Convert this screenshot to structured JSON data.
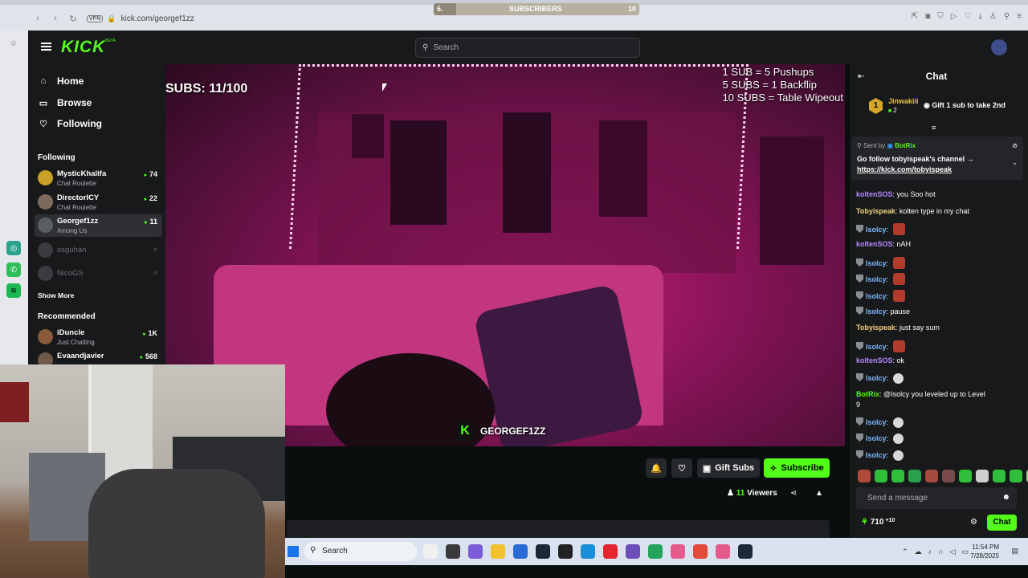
{
  "browser": {
    "url": "kick.com/georgef1zz",
    "vpn_label": "VPN",
    "sub_goal": {
      "left": "6.",
      "label": "SUBSCRIBERS",
      "right": "10",
      "progress": 0.11
    }
  },
  "header": {
    "logo": "KICK",
    "logo_badge": "BETA",
    "search_placeholder": "Search"
  },
  "sidebar": {
    "nav": [
      {
        "label": "Home",
        "icon": "home-icon"
      },
      {
        "label": "Browse",
        "icon": "browse-icon"
      },
      {
        "label": "Following",
        "icon": "heart-icon"
      }
    ],
    "following_title": "Following",
    "following": [
      {
        "name": "MysticKhalifa",
        "category": "Chat Roulette",
        "viewers": "74",
        "online": true,
        "avatar_color": "#c9a227"
      },
      {
        "name": "DirectorICY",
        "category": "Chat Roulette",
        "viewers": "22",
        "online": true,
        "avatar_color": "#7d6a5c"
      },
      {
        "name": "Georgef1zz",
        "category": "Among Us",
        "viewers": "11",
        "online": true,
        "avatar_color": "#5a5e62"
      },
      {
        "name": "osguhan",
        "category": "",
        "viewers": "",
        "online": false,
        "avatar_color": "#6c6f73"
      },
      {
        "name": "NicoGS",
        "category": "",
        "viewers": "",
        "online": false,
        "avatar_color": "#6c6f73"
      }
    ],
    "show_more": "Show More",
    "recommended_title": "Recommended",
    "recommended": [
      {
        "name": "iDuncle",
        "category": "Just Chatting",
        "viewers": "1K",
        "avatar_color": "#8a5a3a"
      },
      {
        "name": "Evaandjavier",
        "category": "",
        "viewers": "568",
        "avatar_color": "#6f5a4a"
      }
    ]
  },
  "stream": {
    "overlay_subs": "SUBS: 11/100",
    "goals": [
      "1 SUB   = 5 Pushups",
      "5 SUBS   = 1 Backflip",
      "10 SUBS = Table Wipeout"
    ],
    "watermark": "GEORGEF1ZZ",
    "gift_subs": "Gift Subs",
    "subscribe": "Subscribe",
    "viewers_count": "11",
    "viewers_label": "Viewers"
  },
  "chat": {
    "title": "Chat",
    "top_gifter": {
      "rank": "1",
      "user": "Jinwakiii",
      "count": "2",
      "cta": "Gift 1 sub to take 2nd"
    },
    "pinned": {
      "sent_by_prefix": "Sent by",
      "sender": "BotRix",
      "message": "Go follow tobyispeak's channel →",
      "link": "https://kick.com/tobyispeak"
    },
    "messages": [
      {
        "user": "koltenSOS",
        "text": "you Soo hot",
        "color": "#b388ff",
        "badge": false,
        "emote": ""
      },
      {
        "user": "Tobyispeak",
        "text": "kolten type in my chat",
        "color": "#f3d37a",
        "badge": false,
        "emote": ""
      },
      {
        "user": "Isolcy",
        "text": "",
        "color": "#7fb8ff",
        "badge": true,
        "emote": "red"
      },
      {
        "user": "koltenSOS",
        "text": "nAH",
        "color": "#b388ff",
        "badge": false,
        "emote": ""
      },
      {
        "user": "Isolcy",
        "text": "",
        "color": "#7fb8ff",
        "badge": true,
        "emote": "red"
      },
      {
        "user": "Isolcy",
        "text": "",
        "color": "#7fb8ff",
        "badge": true,
        "emote": "red"
      },
      {
        "user": "Isolcy",
        "text": "",
        "color": "#7fb8ff",
        "badge": true,
        "emote": "red"
      },
      {
        "user": "Isolcy",
        "text": "pause",
        "color": "#7fb8ff",
        "badge": true,
        "emote": ""
      },
      {
        "user": "Tobyispeak",
        "text": "just say sum",
        "color": "#f3d37a",
        "badge": false,
        "emote": ""
      },
      {
        "user": "Isolcy",
        "text": "",
        "color": "#7fb8ff",
        "badge": true,
        "emote": "red"
      },
      {
        "user": "koltenSOS",
        "text": "ok",
        "color": "#b388ff",
        "badge": false,
        "emote": ""
      },
      {
        "user": "Isolcy",
        "text": "",
        "color": "#7fb8ff",
        "badge": true,
        "emote": "skull"
      },
      {
        "user": "BotRix",
        "text": "@Isolcy you leveled up to Level",
        "color": "#53fc18",
        "badge": false,
        "emote": ""
      },
      {
        "user": "",
        "text": "9",
        "color": "#fff",
        "badge": false,
        "emote": ""
      },
      {
        "user": "Isolcy",
        "text": "",
        "color": "#7fb8ff",
        "badge": true,
        "emote": "skull"
      },
      {
        "user": "Isolcy",
        "text": "",
        "color": "#7fb8ff",
        "badge": true,
        "emote": "skull"
      },
      {
        "user": "Isolcy",
        "text": "",
        "color": "#7fb8ff",
        "badge": true,
        "emote": "skull"
      }
    ],
    "input_placeholder": "Send a message",
    "points": "710",
    "points_plus": "+10",
    "send": "Chat"
  },
  "taskbar": {
    "search": "Search",
    "time": "11:54 PM",
    "date": "7/28/2025"
  },
  "colors": {
    "accent": "#53fc18",
    "panel": "#18191b",
    "bg": "#0b0e0f"
  }
}
